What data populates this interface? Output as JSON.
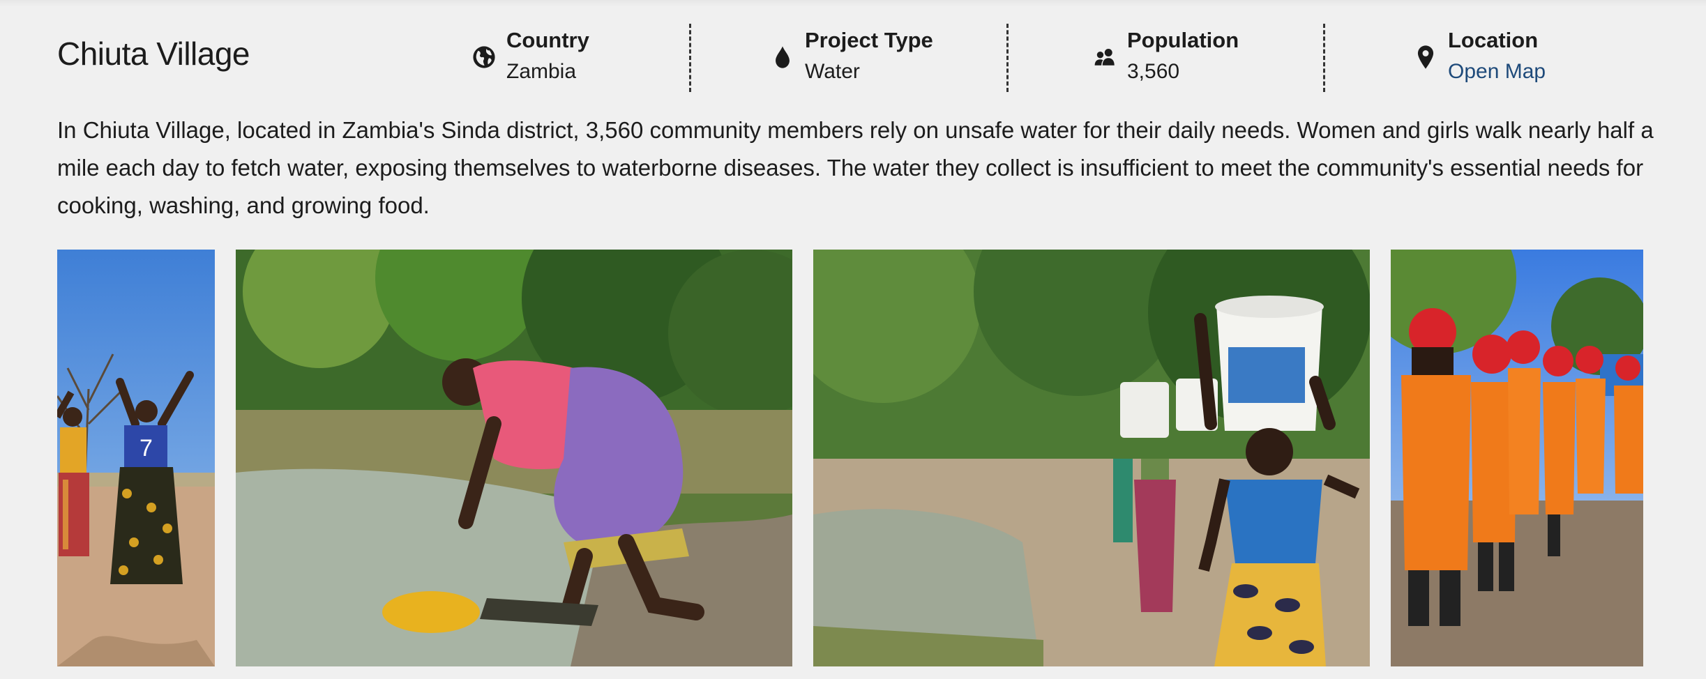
{
  "project": {
    "title": "Chiuta Village",
    "facts": [
      {
        "key": "country",
        "label": "Country",
        "value": "Zambia",
        "icon": "globe-icon"
      },
      {
        "key": "project-type",
        "label": "Project Type",
        "value": "Water",
        "icon": "water-drop-icon"
      },
      {
        "key": "population",
        "label": "Population",
        "value": "3,560",
        "icon": "people-icon"
      },
      {
        "key": "location",
        "label": "Location",
        "value": "Open Map",
        "icon": "map-pin-icon",
        "is_link": true
      }
    ],
    "description": "In Chiuta Village, located in Zambia's Sinda district, 3,560 community members rely on unsafe water for their daily needs. Women and girls walk nearly half a mile each day to fetch water, exposing themselves to waterborne diseases. The water they collect is insufficient to meet the community's essential needs for cooking, washing, and growing food."
  },
  "gallery": {
    "photos": [
      {
        "name": "photo-women-waving"
      },
      {
        "name": "photo-woman-fetching-water"
      },
      {
        "name": "photo-girls-carrying-buckets"
      },
      {
        "name": "photo-workers-orange-uniforms"
      }
    ]
  },
  "colors": {
    "background": "#f0f0f0",
    "text": "#1c1c1c",
    "link": "#1e4a7a"
  }
}
